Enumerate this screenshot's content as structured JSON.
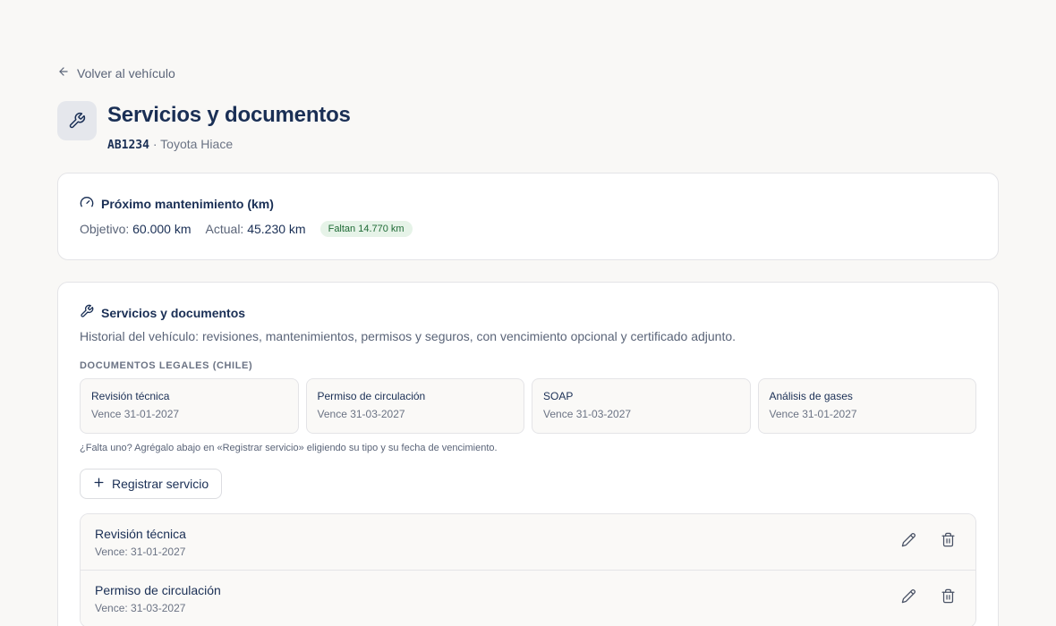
{
  "nav": {
    "back_label": "Volver al vehículo"
  },
  "header": {
    "title": "Servicios y documentos",
    "plate": "AB1234",
    "separator": " · ",
    "vehicle": "Toyota Hiace"
  },
  "km_card": {
    "title": "Próximo mantenimiento (km)",
    "target_label": "Objetivo:",
    "target_value": "60.000 km",
    "current_label": "Actual:",
    "current_value": "45.230 km",
    "remaining_badge": "Faltan 14.770 km"
  },
  "services_card": {
    "title": "Servicios y documentos",
    "description": "Historial del vehículo: revisiones, mantenimientos, permisos y seguros, con vencimiento opcional y certificado adjunto.",
    "legal_section_label": "DOCUMENTOS LEGALES (CHILE)",
    "legal_docs": [
      {
        "name": "Revisión técnica",
        "due": "Vence 31-01-2027"
      },
      {
        "name": "Permiso de circulación",
        "due": "Vence 31-03-2027"
      },
      {
        "name": "SOAP",
        "due": "Vence 31-03-2027"
      },
      {
        "name": "Análisis de gases",
        "due": "Vence 31-01-2027"
      }
    ],
    "hint": "¿Falta uno? Agrégalo abajo en «Registrar servicio» eligiendo su tipo y su fecha de vencimiento.",
    "register_button": "Registrar servicio",
    "services": [
      {
        "name": "Revisión técnica",
        "due": "Vence: 31-01-2027"
      },
      {
        "name": "Permiso de circulación",
        "due": "Vence: 31-03-2027"
      }
    ]
  },
  "colors": {
    "background": "#f9f8f6",
    "primary_text": "#1a2f55",
    "badge_bg": "#e6f3e8",
    "badge_text": "#1f6b36"
  },
  "icons": [
    "arrow-left-icon",
    "wrench-icon",
    "gauge-icon",
    "plus-icon",
    "pencil-icon",
    "trash-icon"
  ]
}
